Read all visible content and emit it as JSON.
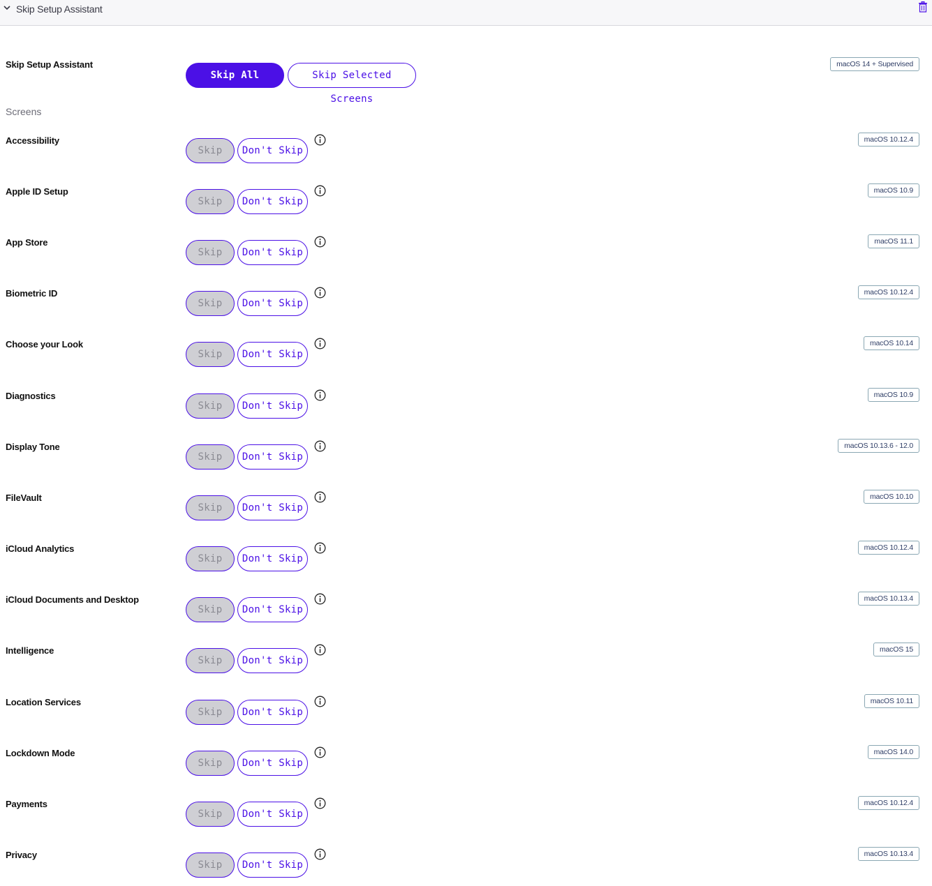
{
  "header": {
    "title": "Skip Setup Assistant"
  },
  "top": {
    "label": "Skip Setup Assistant",
    "skip_all": "Skip All Screens",
    "skip_selected": "Skip Selected Screens",
    "badge": "macOS 14 + Supervised"
  },
  "screens_label": "Screens",
  "skip_label": "Skip",
  "dont_skip_label": "Don't Skip",
  "colors": {
    "accent": "#4b10e6",
    "disabled_bg": "#cfcfd4",
    "badge_border": "#8aa7b3"
  },
  "rows": [
    {
      "name": "Accessibility",
      "version": "macOS 10.12.4"
    },
    {
      "name": "Apple ID Setup",
      "version": "macOS 10.9"
    },
    {
      "name": "App Store",
      "version": "macOS 11.1"
    },
    {
      "name": "Biometric ID",
      "version": "macOS 10.12.4"
    },
    {
      "name": "Choose your Look",
      "version": "macOS 10.14"
    },
    {
      "name": "Diagnostics",
      "version": "macOS 10.9"
    },
    {
      "name": "Display Tone",
      "version": "macOS 10.13.6 - 12.0"
    },
    {
      "name": "FileVault",
      "version": "macOS 10.10"
    },
    {
      "name": "iCloud Analytics",
      "version": "macOS 10.12.4"
    },
    {
      "name": "iCloud Documents and Desktop",
      "version": "macOS 10.13.4"
    },
    {
      "name": "Intelligence",
      "version": "macOS 15"
    },
    {
      "name": "Location Services",
      "version": "macOS 10.11"
    },
    {
      "name": "Lockdown Mode",
      "version": "macOS 14.0"
    },
    {
      "name": "Payments",
      "version": "macOS 10.12.4"
    },
    {
      "name": "Privacy",
      "version": "macOS 10.13.4"
    }
  ]
}
